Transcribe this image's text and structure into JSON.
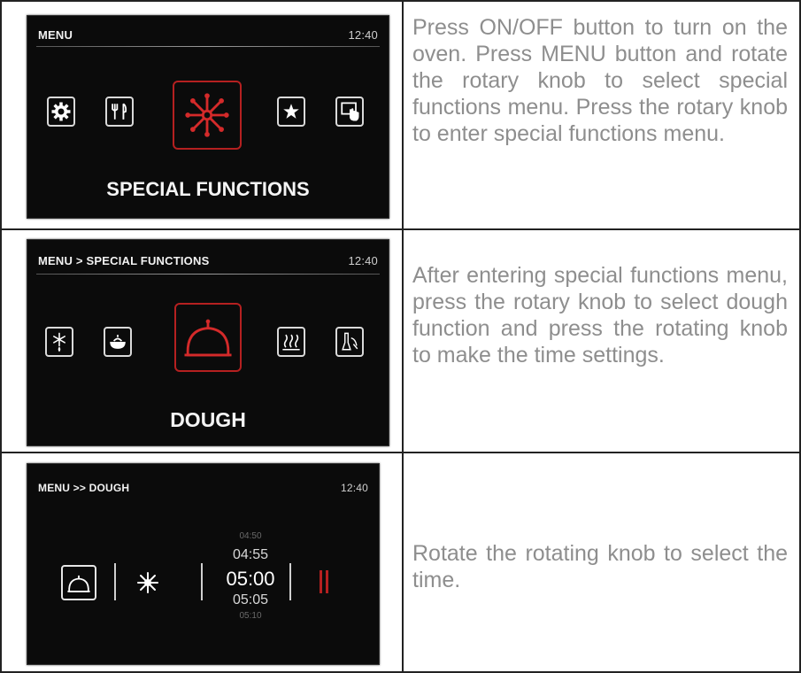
{
  "rows": [
    {
      "screen": {
        "breadcrumb": "MENU",
        "clock": "12:40",
        "title": "SPECIAL FUNCTIONS",
        "icons": [
          "gear-icon",
          "cutlery-icon",
          "special-functions-asterisk-icon",
          "star-icon",
          "touch-hand-icon"
        ]
      },
      "description": "Press ON/OFF button to turn on the oven. Press MENU button and rotate the rotary knob to select special functions menu. Press the rotary knob to enter special functions menu."
    },
    {
      "screen": {
        "breadcrumb": "MENU > SPECIAL FUNCTIONS",
        "clock": "12:40",
        "title": "DOUGH",
        "icons": [
          "defrost-icon",
          "pot-icon",
          "dough-icon",
          "steam-icon",
          "cleaning-icon"
        ]
      },
      "description": "After entering special functions menu, press the rotary knob to select dough function and press the rotating knob to make the time settings."
    },
    {
      "screen": {
        "breadcrumb": "MENU >> DOUGH",
        "clock": "12:40",
        "icons": [
          "dough-icon",
          "sun-icon",
          "pause-icon"
        ],
        "times": [
          "04:50",
          "04:55",
          "05:00",
          "05:05",
          "05:10"
        ]
      },
      "description": "Rotate the rotating knob to select the time."
    }
  ],
  "colors": {
    "accent": "#b52020",
    "screen_bg": "#0b0b0b",
    "text_gray": "#8e8e8e"
  }
}
